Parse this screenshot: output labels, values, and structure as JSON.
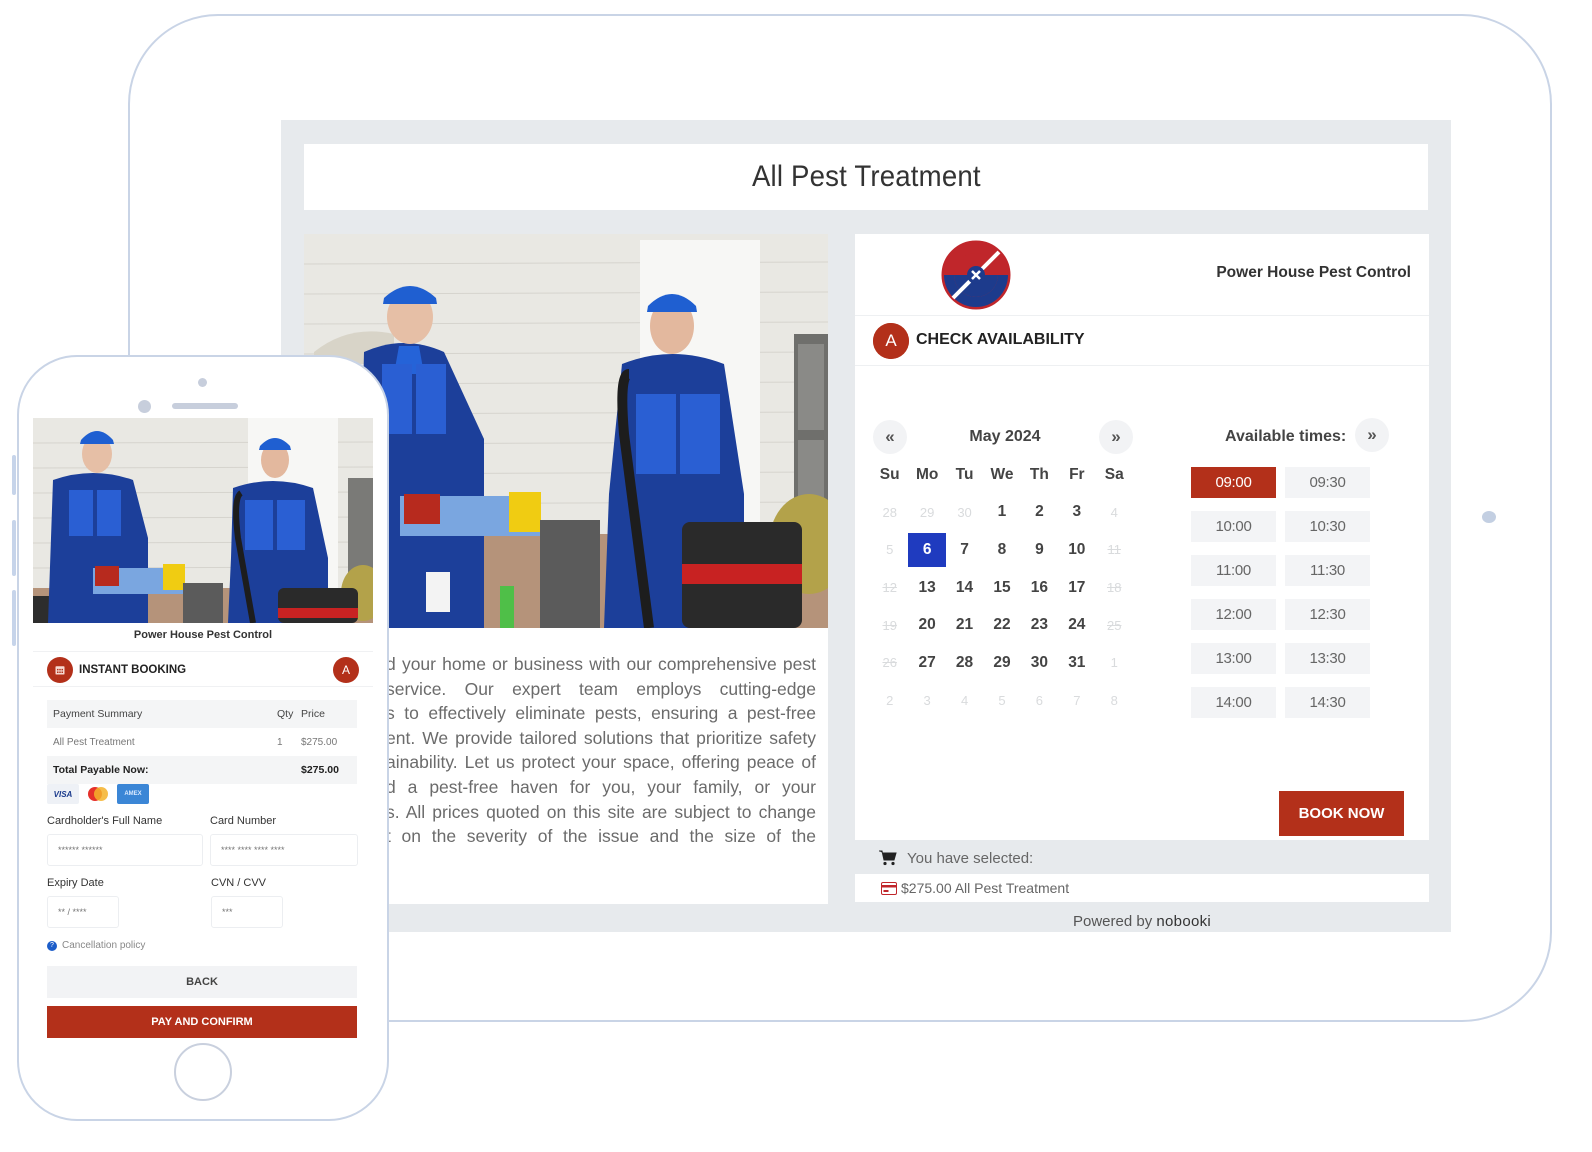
{
  "page_title": "All Pest Treatment",
  "description_lines": [
    "d your home or business with our comprehensive pest",
    "service.  Our  expert  team  employs  cutting-edge",
    "s to effectively eliminate pests, ensuring a pest-free",
    "ent. We provide tailored solutions that prioritize safety",
    "ainability. Let us protect your space, offering peace of",
    "d  a  pest-free  haven  for  you,  your  family,  or  your",
    "s. All prices quoted on this site are subject to change",
    "t  on  the  severity  of  the  issue  and  the  size  of  the"
  ],
  "booking": {
    "business_name": "Power House Pest Control",
    "section_title": "CHECK AVAILABILITY",
    "calendar_icon": "calendar-icon",
    "avatar_letter": "A",
    "calendar": {
      "prev_label": "«",
      "next_label": "»",
      "month_label": "May 2024",
      "weekdays": [
        "Su",
        "Mo",
        "Tu",
        "We",
        "Th",
        "Fr",
        "Sa"
      ],
      "weeks": [
        [
          {
            "d": "28",
            "s": "muted"
          },
          {
            "d": "29",
            "s": "muted"
          },
          {
            "d": "30",
            "s": "muted"
          },
          {
            "d": "1",
            "s": "available"
          },
          {
            "d": "2",
            "s": "available"
          },
          {
            "d": "3",
            "s": "available"
          },
          {
            "d": "4",
            "s": "muted"
          }
        ],
        [
          {
            "d": "5",
            "s": "muted"
          },
          {
            "d": "6",
            "s": "selected"
          },
          {
            "d": "7",
            "s": "available"
          },
          {
            "d": "8",
            "s": "available"
          },
          {
            "d": "9",
            "s": "available"
          },
          {
            "d": "10",
            "s": "available"
          },
          {
            "d": "11",
            "s": "disabled"
          }
        ],
        [
          {
            "d": "12",
            "s": "disabled"
          },
          {
            "d": "13",
            "s": "available"
          },
          {
            "d": "14",
            "s": "available"
          },
          {
            "d": "15",
            "s": "available"
          },
          {
            "d": "16",
            "s": "available"
          },
          {
            "d": "17",
            "s": "available"
          },
          {
            "d": "18",
            "s": "disabled"
          }
        ],
        [
          {
            "d": "19",
            "s": "disabled"
          },
          {
            "d": "20",
            "s": "available"
          },
          {
            "d": "21",
            "s": "available"
          },
          {
            "d": "22",
            "s": "available"
          },
          {
            "d": "23",
            "s": "available"
          },
          {
            "d": "24",
            "s": "available"
          },
          {
            "d": "25",
            "s": "disabled"
          }
        ],
        [
          {
            "d": "26",
            "s": "disabled"
          },
          {
            "d": "27",
            "s": "available"
          },
          {
            "d": "28",
            "s": "available"
          },
          {
            "d": "29",
            "s": "available"
          },
          {
            "d": "30",
            "s": "available"
          },
          {
            "d": "31",
            "s": "available"
          },
          {
            "d": "1",
            "s": "muted"
          }
        ],
        [
          {
            "d": "2",
            "s": "muted"
          },
          {
            "d": "3",
            "s": "muted"
          },
          {
            "d": "4",
            "s": "muted"
          },
          {
            "d": "5",
            "s": "muted"
          },
          {
            "d": "6",
            "s": "muted"
          },
          {
            "d": "7",
            "s": "muted"
          },
          {
            "d": "8",
            "s": "muted"
          }
        ]
      ]
    },
    "times_label": "Available times:",
    "times_next_label": "»",
    "times": [
      {
        "t": "09:00",
        "selected": true
      },
      {
        "t": "09:30",
        "selected": false
      },
      {
        "t": "10:00",
        "selected": false
      },
      {
        "t": "10:30",
        "selected": false
      },
      {
        "t": "11:00",
        "selected": false
      },
      {
        "t": "11:30",
        "selected": false
      },
      {
        "t": "12:00",
        "selected": false
      },
      {
        "t": "12:30",
        "selected": false
      },
      {
        "t": "13:00",
        "selected": false
      },
      {
        "t": "13:30",
        "selected": false
      },
      {
        "t": "14:00",
        "selected": false
      },
      {
        "t": "14:30",
        "selected": false
      }
    ],
    "book_now_label": "BOOK NOW",
    "selected_label": "You have selected:",
    "selected_item": "$275.00 All Pest Treatment",
    "powered_by_prefix": "Powered by",
    "powered_by_brand": "nobooki"
  },
  "phone": {
    "business_name": "Power House Pest Control",
    "section_title": "INSTANT BOOKING",
    "avatar_letter": "A",
    "payment": {
      "headers": [
        "Payment Summary",
        "Qty",
        "Price"
      ],
      "item": {
        "name": "All Pest Treatment",
        "qty": "1",
        "price": "$275.00"
      },
      "total_label": "Total Payable Now:",
      "total_value": "$275.00"
    },
    "cards": [
      "VISA",
      "Mastercard",
      "American Express"
    ],
    "fields": {
      "name_label": "Cardholder's Full Name",
      "name_placeholder": "****** ******",
      "number_label": "Card Number",
      "number_placeholder": "**** **** **** ****",
      "expiry_label": "Expiry Date",
      "expiry_placeholder": "** / ****",
      "cvv_label": "CVN / CVV",
      "cvv_placeholder": "***"
    },
    "cancellation_label": "Cancellation policy",
    "back_label": "BACK",
    "pay_label": "PAY AND CONFIRM"
  },
  "colors": {
    "accent": "#b3301a",
    "selected_date": "#1f3bbf",
    "frame": "#c9d4e6",
    "panel_bg": "#e7eaed"
  }
}
